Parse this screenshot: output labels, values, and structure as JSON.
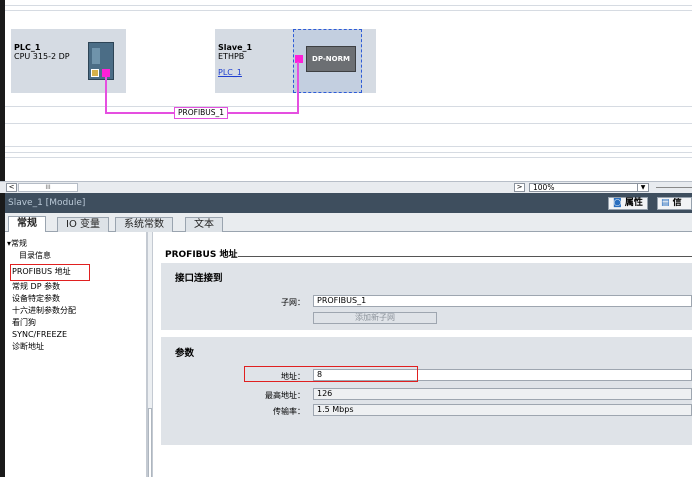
{
  "network": {
    "plc": {
      "name": "PLC_1",
      "type": "CPU 315-2 DP"
    },
    "slave": {
      "name": "Slave_1",
      "type": "ETHPB",
      "link": "PLC_1"
    },
    "module_label": "DP-NORM",
    "network_name": "PROFIBUS_1"
  },
  "statusbar": {
    "zoom": "100%",
    "scroll_left": "<",
    "scroll_right": ">",
    "scroll_thumb": "III",
    "zoom_dropdown": "▼"
  },
  "inspector": {
    "title": "Slave_1 [Module]",
    "properties_label": "属性",
    "info_label": "信",
    "tabs": [
      "常规",
      "IO 变量",
      "系统常数",
      "文本"
    ]
  },
  "tree": {
    "root": "常规",
    "items": [
      "目录信息",
      "PROFIBUS 地址",
      "常规 DP 参数",
      "设备特定参数",
      "十六进制参数分配",
      "看门狗",
      "SYNC/FREEZE",
      "诊断地址"
    ]
  },
  "content": {
    "section_title": "PROFIBUS 地址",
    "interface_heading": "接口连接到",
    "subnet_label": "子网：",
    "subnet_value": "PROFIBUS_1",
    "add_subnet_button": "添加新子网",
    "params_heading": "参数",
    "address_label": "地址：",
    "address_value": "8",
    "max_address_label": "最高地址：",
    "max_address_value": "126",
    "baud_label": "传输率：",
    "baud_value": "1.5 Mbps"
  },
  "colors": {
    "profibus_line": "#e54fe0",
    "highlight_box": "#e02020",
    "inspector_title_bg": "#3e4e5e"
  }
}
